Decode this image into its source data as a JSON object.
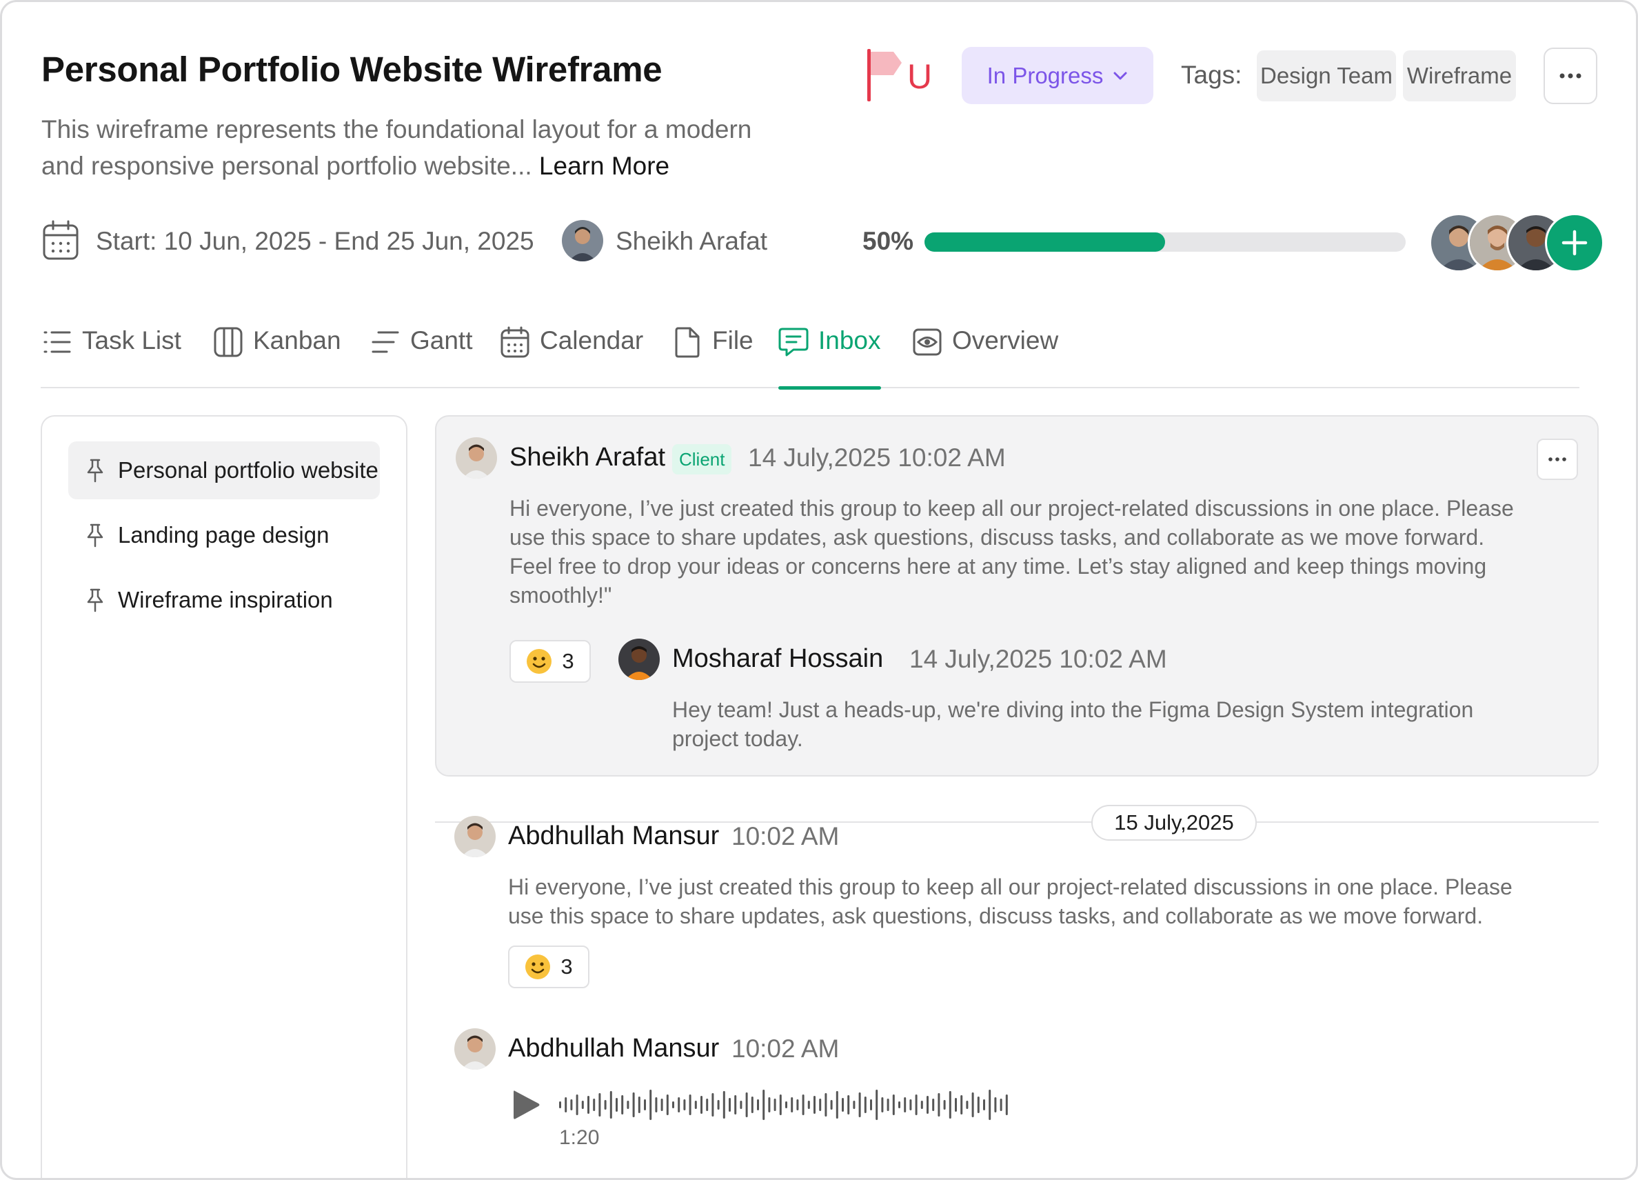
{
  "project": {
    "title": "Personal Portfolio Website Wireframe",
    "description": "This wireframe represents the foundational layout for a modern and responsive personal portfolio website...",
    "learn_more": "Learn More",
    "priority_label": "U",
    "status": "In Progress",
    "tags_label": "Tags:",
    "tags": [
      "Design Team",
      "Wireframe"
    ],
    "dates": "Start: 10 Jun, 2025 - End 25 Jun, 2025",
    "owner": "Sheikh Arafat",
    "progress_label": "50%",
    "progress": 0.5
  },
  "colors": {
    "accent": "#0aa472",
    "status_bg": "#ebe6fd",
    "status_text": "#7c55e8",
    "priority": "#e5394c"
  },
  "tabs": [
    {
      "label": "Task List",
      "icon": "list-icon"
    },
    {
      "label": "Kanban",
      "icon": "kanban-icon"
    },
    {
      "label": "Gantt",
      "icon": "gantt-icon"
    },
    {
      "label": "Calendar",
      "icon": "calendar-icon"
    },
    {
      "label": "File",
      "icon": "file-icon"
    },
    {
      "label": "Inbox",
      "icon": "chat-icon",
      "active": true
    },
    {
      "label": "Overview",
      "icon": "eye-icon"
    }
  ],
  "sidebar": {
    "items": [
      {
        "label": "Personal portfolio website",
        "selected": true
      },
      {
        "label": "Landing page design"
      },
      {
        "label": "Wireframe inspiration"
      }
    ]
  },
  "messages": {
    "m1": {
      "author": "Sheikh Arafat",
      "badge": "Client",
      "time": "14 July,2025 10:02 AM",
      "text": "Hi everyone, I’ve just created this group to keep all our project-related discussions in one place. Please use this space to share updates, ask questions, discuss tasks, and collaborate as we move forward. Feel free to drop your ideas or concerns here at any time. Let’s stay aligned and keep things moving smoothly!\"",
      "reaction_count": "3"
    },
    "reply": {
      "author": "Mosharaf Hossain",
      "time": "14 July,2025 10:02 AM",
      "text": "Hey team! Just a heads-up, we're diving into the Figma Design System integration project today."
    },
    "date_separator": "15 July,2025",
    "m2": {
      "author": "Abdhullah Mansur",
      "time": "10:02 AM",
      "text": "Hi everyone, I’ve just created this group to keep all our project-related discussions in one place. Please use this space to share updates, ask questions, discuss tasks, and collaborate as we move forward.",
      "reaction_count": "3"
    },
    "m3": {
      "author": "Abdhullah Mansur",
      "time": "10:02 AM",
      "audio_duration": "1:20"
    }
  }
}
